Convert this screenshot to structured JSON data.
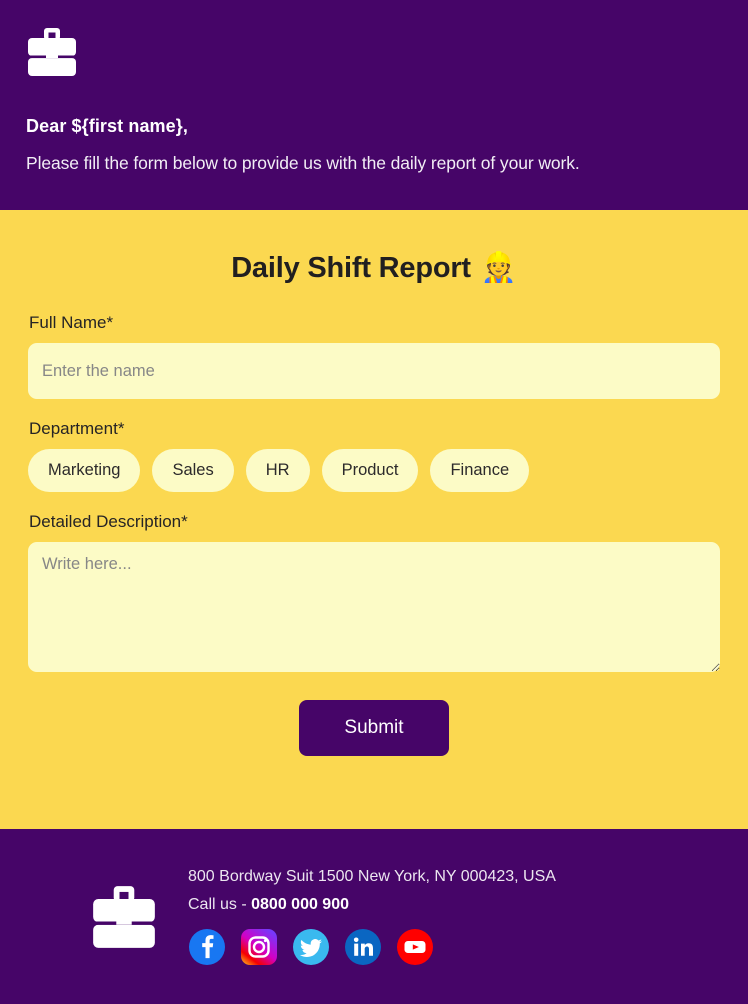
{
  "header": {
    "logo_icon": "briefcase-icon",
    "greeting": "Dear ${first name},",
    "subtitle": "Please fill the form below to provide us with the daily report of your work.",
    "bg_color": "#460568"
  },
  "form": {
    "title": "Daily Shift Report",
    "title_emoji": "👷",
    "title_emoji_name": "construction-worker-emoji",
    "bg_color": "#fbd850",
    "input_bg_color": "#fcfbc6",
    "fields": {
      "full_name": {
        "label": "Full Name*",
        "placeholder": "Enter the name",
        "value": ""
      },
      "department": {
        "label": "Department*",
        "options": [
          "Marketing",
          "Sales",
          "HR",
          "Product",
          "Finance"
        ]
      },
      "detailed_description": {
        "label": "Detailed Description*",
        "placeholder": "Write here...",
        "value": ""
      }
    },
    "submit_label": "Submit"
  },
  "footer": {
    "logo_icon": "briefcase-icon",
    "address": "800 Bordway Suit 1500 New York, NY 000423, USA",
    "call_prefix": "Call us - ",
    "phone": "0800 000 900",
    "bg_color": "#460568",
    "social": [
      {
        "name": "facebook-icon",
        "color": "#1877f2"
      },
      {
        "name": "instagram-icon",
        "color": "#d62976"
      },
      {
        "name": "twitter-icon",
        "color": "#3ab9ef"
      },
      {
        "name": "linkedin-icon",
        "color": "#0a66c2"
      },
      {
        "name": "youtube-icon",
        "color": "#ff0000"
      }
    ]
  }
}
